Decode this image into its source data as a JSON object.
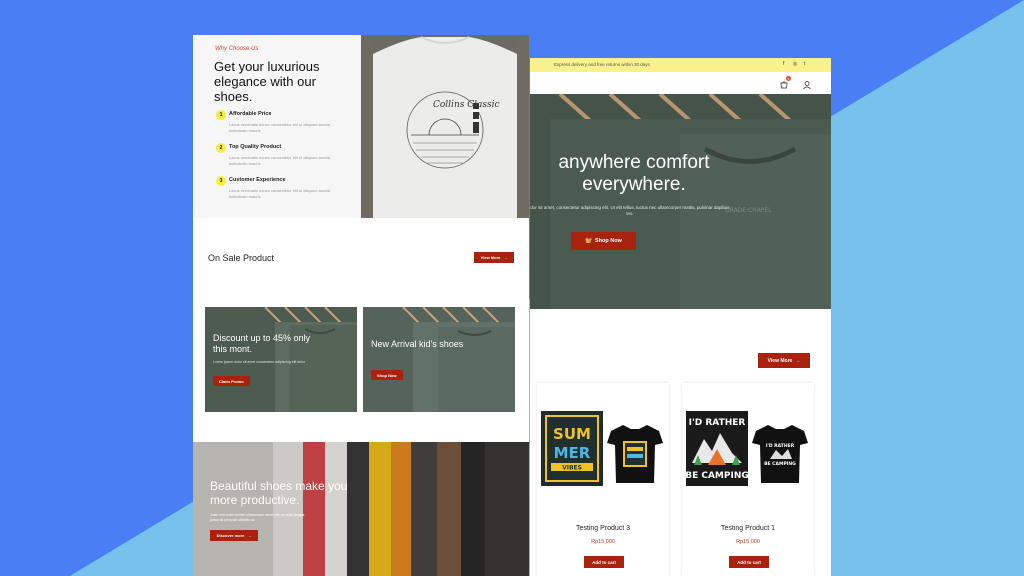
{
  "left_page": {
    "why": {
      "eyebrow": "Why Choose Us",
      "title": "Get your luxurious elegance with our shoes.",
      "features": [
        {
          "num": "1",
          "title": "Affordable Price",
          "desc": "Lacus venenatis donec consectetur elit ut aliquam lacinia sollicitudin mauris"
        },
        {
          "num": "2",
          "title": "Top Quality Product",
          "desc": "Lacus venenatis donec consectetur elit ut aliquam lacinia sollicitudin mauris"
        },
        {
          "num": "3",
          "title": "Customer Experience",
          "desc": "Lacus venenatis donec consectetur elit ut aliquam lacinia sollicitudin mauris"
        }
      ]
    },
    "sale": {
      "heading": "On Sale Product",
      "view_more": "View More"
    },
    "promos": [
      {
        "title": "Discount up to 45% only this mont.",
        "desc": "Lorem ipsum dolor sit amet consectetur adipiscing elit dolor",
        "button": "Claim Promo"
      },
      {
        "title": "New Arrival kid's shoes",
        "desc": "",
        "button": "Shop Now"
      }
    ],
    "beautiful": {
      "title": "Beautiful shoes make you more productive.",
      "desc": "Justo sed enim laoreet ullamcorper amet nec ac nulla feugiat purus sit perspicit ultricies ac",
      "button": "Discover more"
    }
  },
  "right_page": {
    "announcement": "Express delivery and free returns within 30 days",
    "social": [
      "f",
      "◎",
      "t"
    ],
    "cart_count": "0",
    "hero": {
      "title": "anywhere comfort everywhere.",
      "desc": "dor sit amet, consectetur adipiscing elit. Ut elit tellus, luctus nec ullamcorper mattis, pulvinar dapibus leo.",
      "button": "Shop Now"
    },
    "view_more": "View More",
    "products": [
      {
        "name": "Testing Product 3",
        "price": "Rp15,000",
        "button": "Add to cart",
        "art": "summer"
      },
      {
        "name": "Testing Product 1",
        "price": "Rp15,000",
        "button": "Add to cart",
        "art": "camping"
      }
    ],
    "shirt_text": {
      "summer": [
        "SUM",
        "MER",
        "VIBES"
      ],
      "camping": [
        "I'D RATHER",
        "BE CAMPING"
      ]
    }
  },
  "colors": {
    "accent": "#a8220e",
    "background": "#4a7ef5",
    "announcement_bar": "#f9f18a",
    "badge": "#f7ee3c"
  }
}
